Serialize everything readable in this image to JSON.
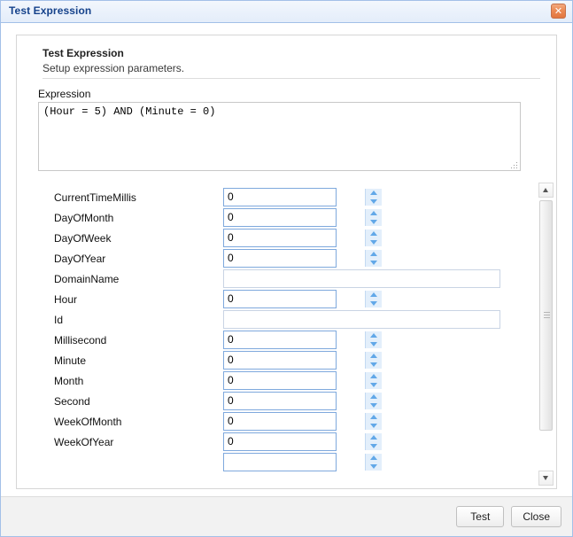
{
  "window": {
    "title": "Test Expression",
    "close_icon": "close-icon",
    "close_label": "✕"
  },
  "header": {
    "title": "Test Expression",
    "subtitle": "Setup expression parameters."
  },
  "expression": {
    "label": "Expression",
    "value": "(Hour = 5) AND (Minute = 0)",
    "placeholder": "",
    "resize_grip_icon": "resize-grip-icon"
  },
  "parameters": [
    {
      "label": "CurrentTimeMillis",
      "type": "spinner",
      "value": "0"
    },
    {
      "label": "DayOfMonth",
      "type": "spinner",
      "value": "0"
    },
    {
      "label": "DayOfWeek",
      "type": "spinner",
      "value": "0"
    },
    {
      "label": "DayOfYear",
      "type": "spinner",
      "value": "0"
    },
    {
      "label": "DomainName",
      "type": "text",
      "value": ""
    },
    {
      "label": "Hour",
      "type": "spinner",
      "value": "0"
    },
    {
      "label": "Id",
      "type": "text",
      "value": ""
    },
    {
      "label": "Millisecond",
      "type": "spinner",
      "value": "0"
    },
    {
      "label": "Minute",
      "type": "spinner",
      "value": "0"
    },
    {
      "label": "Month",
      "type": "spinner",
      "value": "0"
    },
    {
      "label": "Second",
      "type": "spinner",
      "value": "0"
    },
    {
      "label": "WeekOfMonth",
      "type": "spinner",
      "value": "0"
    },
    {
      "label": "WeekOfYear",
      "type": "spinner",
      "value": "0"
    },
    {
      "label": "",
      "type": "spinner",
      "value": ""
    }
  ],
  "scrollbar": {
    "up_icon": "scroll-up-arrow-icon",
    "down_icon": "scroll-down-arrow-icon",
    "thumb_icon": "scrollbar-thumb-grip-icon"
  },
  "footer": {
    "test_label": "Test",
    "close_label": "Close"
  },
  "colors": {
    "titlebar_text": "#15428b",
    "titlebar_bg": "#eaf1fb",
    "window_border": "#a3c0e8",
    "close_button": "#e2763f",
    "spinner_arrow": "#62a8e8",
    "field_border_focus": "#7fa9dd",
    "footer_bg": "#f2f2f2"
  }
}
